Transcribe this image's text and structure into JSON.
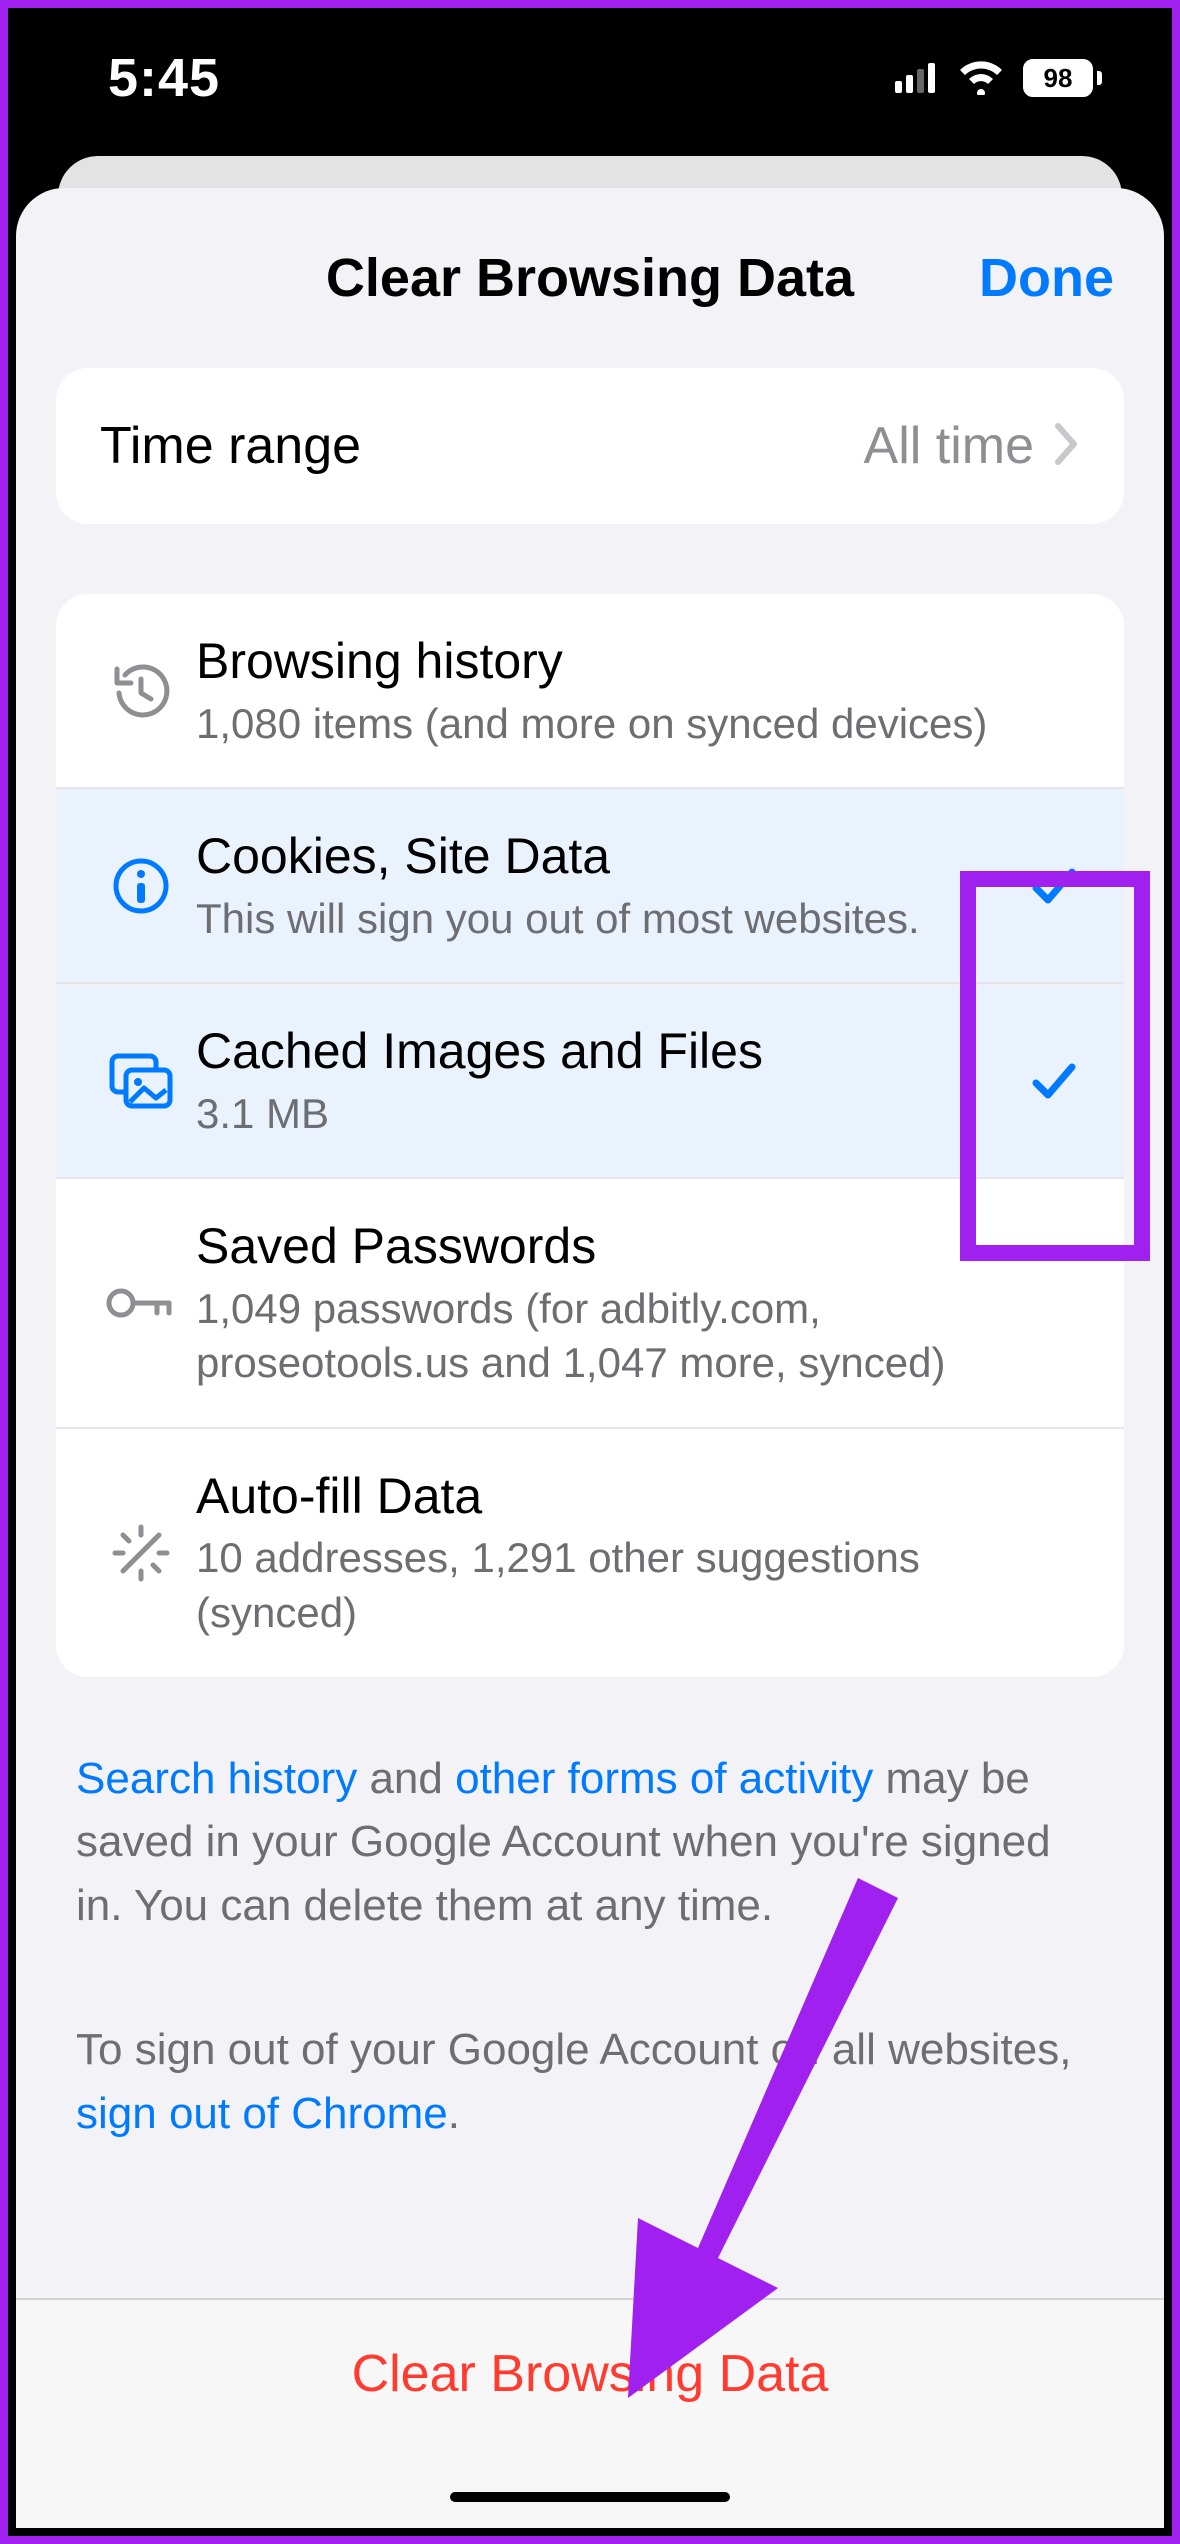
{
  "status": {
    "time": "5:45",
    "battery": "98"
  },
  "header": {
    "title": "Clear Browsing Data",
    "done": "Done"
  },
  "time_range": {
    "label": "Time range",
    "value": "All time"
  },
  "options": [
    {
      "title": "Browsing history",
      "subtitle": "1,080 items (and more on synced devices)",
      "selected": false,
      "icon": "history"
    },
    {
      "title": "Cookies, Site Data",
      "subtitle": "This will sign you out of most websites.",
      "selected": true,
      "icon": "info"
    },
    {
      "title": "Cached Images and Files",
      "subtitle": "3.1 MB",
      "selected": true,
      "icon": "images"
    },
    {
      "title": "Saved Passwords",
      "subtitle": "1,049 passwords (for adbitly.com, proseotools.us and 1,047 more, synced)",
      "selected": false,
      "icon": "key"
    },
    {
      "title": "Auto-fill Data",
      "subtitle": "10 addresses, 1,291 other suggestions (synced)",
      "selected": false,
      "icon": "wand"
    }
  ],
  "footer": {
    "link_search_history": "Search history",
    "text_1a": " and ",
    "link_other_forms": "other forms of activity",
    "text_1b": " may be saved in your Google Account when you're signed in. You can delete them at any time.",
    "text_2a": "To sign out of your Google Account on all websites, ",
    "link_signout": "sign out of Chrome",
    "text_2b": "."
  },
  "bottom": {
    "clear": "Clear Browsing Data"
  }
}
